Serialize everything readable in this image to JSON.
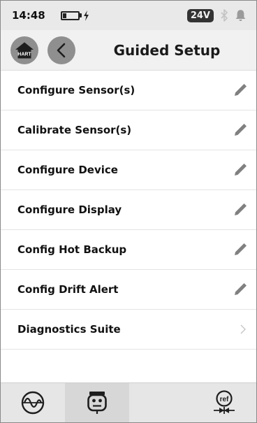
{
  "status_bar": {
    "time": "14:48",
    "voltage": "24V",
    "icons": [
      "battery-charging-icon",
      "bluetooth-icon",
      "bell-icon"
    ]
  },
  "header": {
    "title": "Guided Setup",
    "home_badge": "HART",
    "icons": [
      "home-icon",
      "back-arrow-icon"
    ]
  },
  "menu": {
    "items": [
      {
        "label": "Configure Sensor(s)",
        "icon": "pencil-icon"
      },
      {
        "label": "Calibrate Sensor(s)",
        "icon": "pencil-icon"
      },
      {
        "label": "Configure Device",
        "icon": "pencil-icon"
      },
      {
        "label": "Configure Display",
        "icon": "pencil-icon"
      },
      {
        "label": "Config Hot Backup",
        "icon": "pencil-icon"
      },
      {
        "label": "Config Drift Alert",
        "icon": "pencil-icon"
      },
      {
        "label": "Diagnostics Suite",
        "icon": "chevron-right-icon"
      }
    ]
  },
  "bottom_bar": {
    "tabs": [
      {
        "icon": "waveform-icon"
      },
      {
        "icon": "device-status-icon"
      },
      {
        "icon": "ref-icon",
        "text": "ref"
      }
    ]
  },
  "colors": {
    "status_bg": "#e9e9e9",
    "header_bg": "#f1f1f1",
    "button_gray": "#8f8f8f",
    "bottom_bg": "#e6e6e6"
  }
}
